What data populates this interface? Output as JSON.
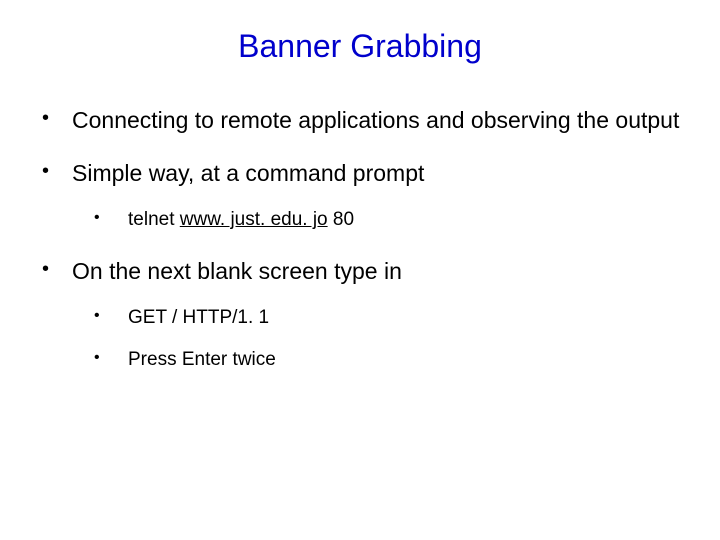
{
  "title": "Banner Grabbing",
  "bullets": {
    "b1": "Connecting to remote applications and observing the output",
    "b2": "Simple way, at a command prompt",
    "b2_sub1_prefix": "telnet ",
    "b2_sub1_link": "www. just. edu. jo",
    "b2_sub1_suffix": " 80",
    "b3": "On the next blank screen type in",
    "b3_sub1": "GET / HTTP/1. 1",
    "b3_sub2": "Press Enter twice"
  }
}
